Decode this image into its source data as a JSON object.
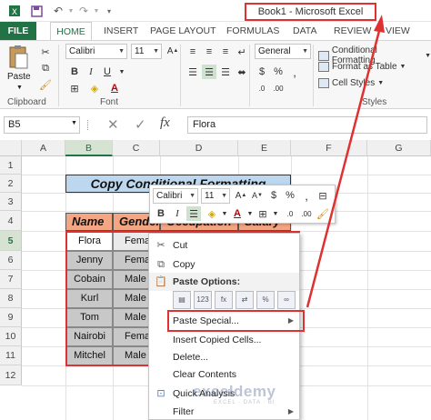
{
  "window": {
    "title": "Book1 - Microsoft Excel"
  },
  "ribbon": {
    "tabs": [
      "FILE",
      "HOME",
      "INSERT",
      "PAGE LAYOUT",
      "FORMULAS",
      "DATA",
      "REVIEW",
      "VIEW"
    ],
    "active_tab": "HOME",
    "paste_label": "Paste",
    "font_name": "Calibri",
    "font_size": "11",
    "number_format": "General",
    "groups": {
      "clipboard": "Clipboard",
      "font": "Font",
      "styles": "Styles"
    },
    "styles_items": [
      "Conditional Formatting",
      "Format as Table",
      "Cell Styles"
    ]
  },
  "formula_bar": {
    "name_box": "B5",
    "fx_label": "fx",
    "content": "Flora"
  },
  "grid": {
    "columns": [
      "A",
      "B",
      "C",
      "D",
      "E",
      "F",
      "G"
    ],
    "rows": [
      "1",
      "2",
      "3",
      "4",
      "5",
      "6",
      "7",
      "8",
      "9",
      "10",
      "11",
      "12"
    ],
    "selected_column": "B",
    "selected_row": "5",
    "title_cell": "Copy Conditional Formatting",
    "headers": [
      "Name",
      "Gender",
      "Occupation",
      "Salary"
    ],
    "names": [
      "Flora",
      "Jenny",
      "Cobain",
      "Kurl",
      "Tom",
      "Nairobi",
      "Mitchel"
    ],
    "genders": [
      "Femal",
      "Femal",
      "Male",
      "Male",
      "Male",
      "Femal",
      "Male"
    ]
  },
  "mini_toolbar": {
    "font_name": "Calibri",
    "font_size": "11"
  },
  "context_menu": {
    "cut": "Cut",
    "copy": "Copy",
    "paste_options": "Paste Options:",
    "paste_special": "Paste Special...",
    "insert_copied": "Insert Copied Cells...",
    "delete": "Delete...",
    "clear_contents": "Clear Contents",
    "quick_analysis": "Quick Analysis",
    "filter": "Filter"
  },
  "watermark": {
    "brand": "exceldemy",
    "tagline": "EXCEL · DATA · BI"
  },
  "colors": {
    "excel_green": "#217346",
    "highlight_red": "#e03030",
    "title_fill": "#bdd7ee",
    "header_fill": "#f4a582"
  }
}
